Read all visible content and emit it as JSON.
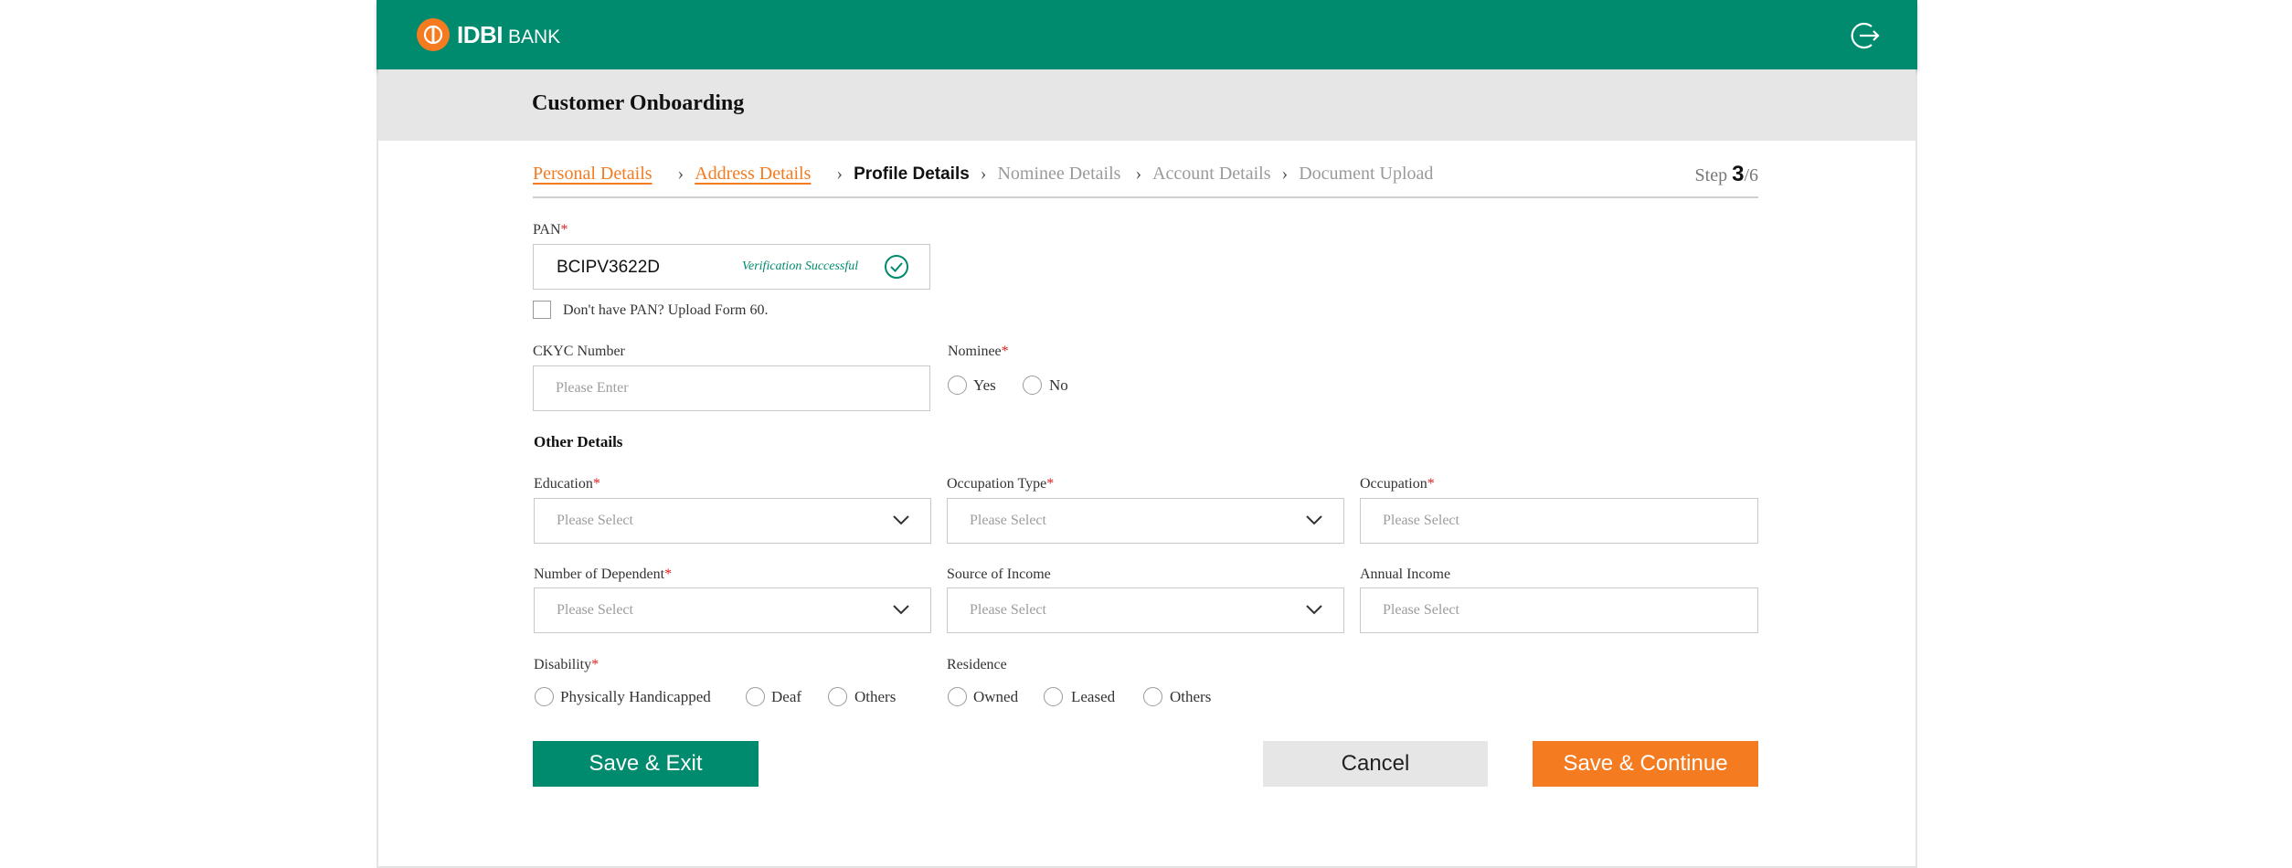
{
  "header": {
    "logo_brand": "IDBI",
    "logo_bank": "BANK",
    "logout_icon": "logout-icon",
    "accent": "#008a6e",
    "brand_orange": "#f47b20"
  },
  "page": {
    "title": "Customer Onboarding"
  },
  "stepper": {
    "steps": [
      {
        "label": "Personal Details",
        "state": "done"
      },
      {
        "label": "Address Details",
        "state": "done"
      },
      {
        "label": "Profile Details",
        "state": "current"
      },
      {
        "label": "Nominee Details",
        "state": "pending"
      },
      {
        "label": "Account Details",
        "state": "pending"
      },
      {
        "label": "Document Upload",
        "state": "pending"
      }
    ],
    "step_prefix": "Step",
    "step_current": "3",
    "step_total": "/6"
  },
  "pan": {
    "label": "PAN",
    "value": "BCIPV3622D",
    "status": "Verification Successful",
    "no_pan_label": "Don't have PAN? Upload Form 60."
  },
  "ckyc": {
    "label": "CKYC Number",
    "placeholder": "Please Enter"
  },
  "nominee": {
    "label": "Nominee",
    "options": [
      "Yes",
      "No"
    ]
  },
  "other_details": {
    "title": "Other Details",
    "education": {
      "label": "Education",
      "placeholder": "Please Select"
    },
    "occupation_type": {
      "label": "Occupation Type",
      "placeholder": "Please Select"
    },
    "occupation": {
      "label": "Occupation",
      "placeholder": "Please Select"
    },
    "dependents": {
      "label": "Number of Dependent",
      "placeholder": "Please Select"
    },
    "source_income": {
      "label": "Source of Income",
      "placeholder": "Please Select"
    },
    "annual_income": {
      "label": "Annual Income",
      "placeholder": "Please Select"
    },
    "disability": {
      "label": "Disability",
      "options": [
        "Physically Handicapped",
        "Deaf",
        "Others"
      ]
    },
    "residence": {
      "label": "Residence",
      "options": [
        "Owned",
        "Leased",
        "Others"
      ]
    }
  },
  "required_mark": "*",
  "actions": {
    "save_exit": "Save & Exit",
    "cancel": "Cancel",
    "save_continue": "Save & Continue"
  }
}
